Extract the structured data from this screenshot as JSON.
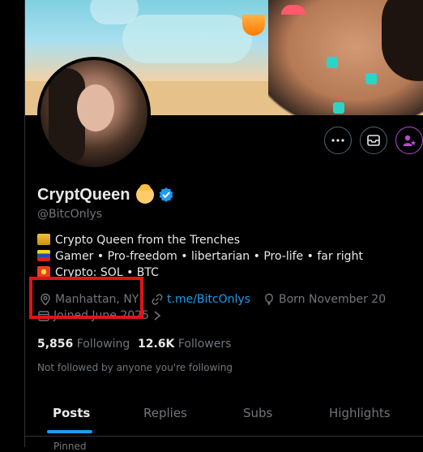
{
  "profile": {
    "display_name": "CryptQueen",
    "handle": "@BitcOnlys",
    "verified": true,
    "bio": [
      "Crypto Queen from the Trenches",
      "Gamer • Pro-freedom • libertarian • Pro-life • far right",
      "Crypto: SOL • BTC"
    ],
    "location": "Manhattan, NY",
    "link": "t.me/BitcOnlys",
    "born": "Born November 20",
    "joined": "Joined June 2025",
    "following_count": "5,856",
    "following_label": "Following",
    "followers_count": "12.6K",
    "followers_label": "Followers",
    "not_followed_text": "Not followed by anyone you're following"
  },
  "tabs": [
    "Posts",
    "Replies",
    "Subs",
    "Highlights"
  ],
  "pinned_label": "Pinned",
  "colors": {
    "accent": "#1d9bf0",
    "highlight_box": "#e0141a",
    "subscribe": "#b44bd6"
  },
  "icons": [
    "more-icon",
    "message-icon",
    "subscribe-icon",
    "verified-icon",
    "location-icon",
    "link-icon",
    "balloon-icon",
    "calendar-icon"
  ]
}
